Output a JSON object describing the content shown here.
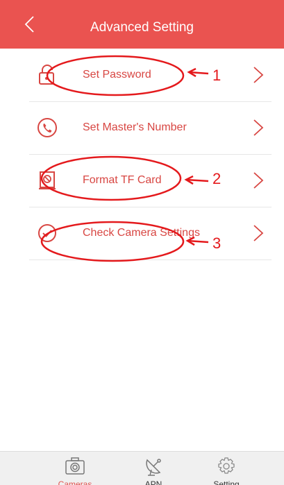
{
  "header": {
    "title": "Advanced Setting",
    "back_icon": "chevron-left-icon",
    "background": "#ea5350"
  },
  "menu": {
    "items": [
      {
        "label": "Set Password",
        "icon": "lock-icon"
      },
      {
        "label": "Set Master's Number",
        "icon": "phone-icon"
      },
      {
        "label": "Format TF Card",
        "icon": "sd-card-icon"
      },
      {
        "label": "Check Camera Settings",
        "icon": "check-circle-icon"
      }
    ],
    "chevron_icon": "chevron-right-icon"
  },
  "annotations": {
    "markers": [
      "1",
      "2",
      "3"
    ],
    "color": "#e4191c"
  },
  "tabbar": {
    "tabs": [
      {
        "label": "Cameras",
        "icon": "camera-icon",
        "active": true
      },
      {
        "label": "APN",
        "icon": "satellite-dish-icon",
        "active": false
      },
      {
        "label": "Setting",
        "icon": "gear-icon",
        "active": false
      }
    ],
    "active_color": "#e0524f"
  }
}
